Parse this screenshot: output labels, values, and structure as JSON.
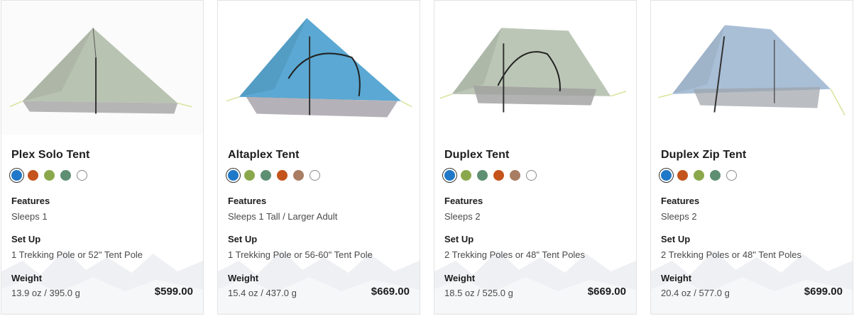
{
  "labels": {
    "features": "Features",
    "setup": "Set Up",
    "weight": "Weight"
  },
  "products": [
    {
      "name": "Plex Solo Tent",
      "features": "Sleeps 1",
      "setup": "1 Trekking Pole or 52\" Tent Pole",
      "weight": "13.9 oz / 395.0 g",
      "price": "$599.00",
      "tent_color": "#b9c3b2",
      "swatches": [
        "#1f78c8",
        "#c4541b",
        "#8aa84b",
        "#5f8f73",
        "#ffffff"
      ]
    },
    {
      "name": "Altaplex Tent",
      "features": "Sleeps 1 Tall / Larger Adult",
      "setup": "1 Trekking Pole or 56-60\" Tent Pole",
      "weight": "15.4 oz / 437.0 g",
      "price": "$669.00",
      "tent_color": "#5aa8d3",
      "swatches": [
        "#1f78c8",
        "#8aa84b",
        "#5f8f73",
        "#c4541b",
        "#a87d62",
        "#ffffff"
      ]
    },
    {
      "name": "Duplex Tent",
      "features": "Sleeps 2",
      "setup": "2 Trekking Poles or 48\" Tent Poles",
      "weight": "18.5 oz / 525.0 g",
      "price": "$669.00",
      "tent_color": "#bcc6b6",
      "swatches": [
        "#1f78c8",
        "#8aa84b",
        "#5f8f73",
        "#c4541b",
        "#a87d62",
        "#ffffff"
      ]
    },
    {
      "name": "Duplex Zip Tent",
      "features": "Sleeps 2",
      "setup": "2 Trekking Poles or 48\" Tent Poles",
      "weight": "20.4 oz / 577.0 g",
      "price": "$699.00",
      "tent_color": "#a9bfd6",
      "swatches": [
        "#1f78c8",
        "#c4541b",
        "#8aa84b",
        "#5f8f73",
        "#ffffff"
      ]
    }
  ]
}
